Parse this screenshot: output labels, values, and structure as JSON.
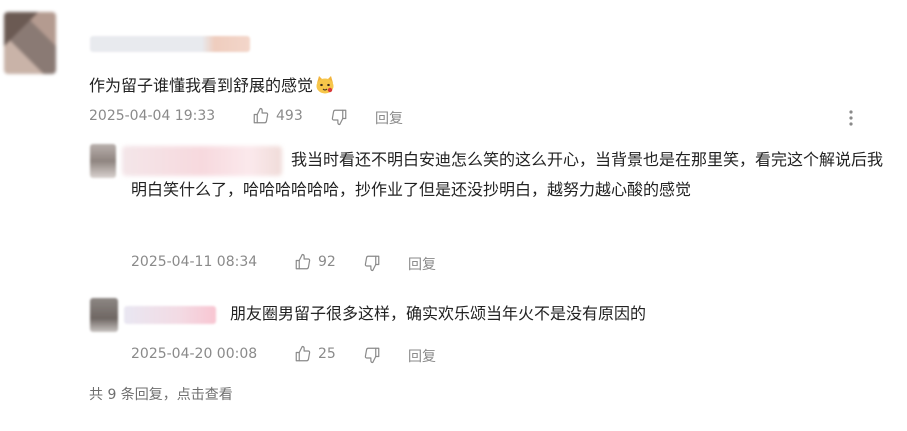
{
  "comment": {
    "text": "作为留子谁懂我看到舒展的感觉",
    "emoji": "cat-face-emoji",
    "time": "2025-04-04 19:33",
    "likes": "493",
    "reply_label": "回复"
  },
  "replies": [
    {
      "text": "我当时看还不明白安迪怎么笑的这么开心，当背景也是在那里笑，看完这个解说后我明白笑什么了，哈哈哈哈哈哈，抄作业了但是还没抄明白，越努力越心酸的感觉",
      "time": "2025-04-11 08:34",
      "likes": "92",
      "reply_label": "回复"
    },
    {
      "text": "朋友圈男留子很多这样，确实欢乐颂当年火不是没有原因的",
      "time": "2025-04-20 00:08",
      "likes": "25",
      "reply_label": "回复"
    }
  ],
  "summary": "共 9 条回复，点击查看",
  "icons": {
    "like": "thumbs-up-icon",
    "dislike": "thumbs-down-icon",
    "more": "more-vertical-icon"
  },
  "colors": {
    "text": "#222222",
    "meta": "#8a8a8a",
    "summary": "#6f6f6f"
  }
}
